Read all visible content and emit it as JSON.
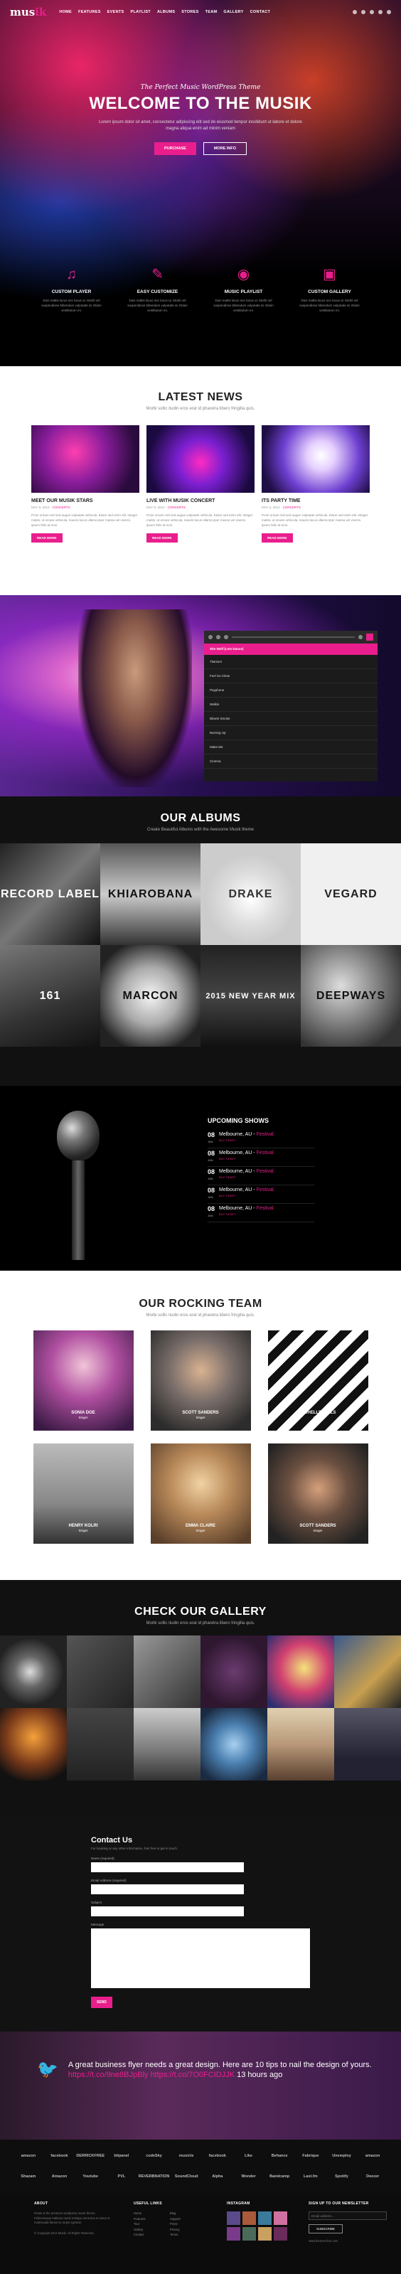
{
  "header": {
    "logo_main": "mus",
    "logo_accent": "ik",
    "menu": [
      "HOME",
      "FEATURES",
      "EVENTS",
      "PLAYLIST",
      "ALBUMS",
      "STORES",
      "TEAM",
      "GALLERY",
      "CONTACT"
    ]
  },
  "hero": {
    "subtitle": "The Perfect Music WordPress Theme",
    "title": "WELCOME TO THE MUSIK",
    "text": "Lorem ipsum dolor sit amet, consectetur adipiscing elit sed do eiusmod tempor incididunt ut labore et dolore magna aliqua enim ad minim veniam",
    "btn_primary": "PURCHASE",
    "btn_secondary": "MORE INFO"
  },
  "features": [
    {
      "icon": "music-note-icon",
      "title": "CUSTOM PLAYER",
      "text": "Duis mattis lacus nec lacus ut. Morbi vel suspendisse bibendum vulputate at. Etiam vestibulum mi."
    },
    {
      "icon": "pencil-icon",
      "title": "EASY CUSTOMIZE",
      "text": "Duis mattis lacus nec lacus ut. Morbi vel suspendisse bibendum vulputate at. Etiam vestibulum mi."
    },
    {
      "icon": "record-icon",
      "title": "MUSIC PLAYLIST",
      "text": "Duis mattis lacus nec lacus ut. Morbi vel suspendisse bibendum vulputate at. Etiam vestibulum mi."
    },
    {
      "icon": "image-icon",
      "title": "CUSTOM GALLERY",
      "text": "Duis mattis lacus nec lacus ut. Morbi vel suspendisse bibendum vulputate at. Etiam vestibulum mi."
    }
  ],
  "news": {
    "title": "LATEST NEWS",
    "subtitle": "Morbi sollic itudin eros erat id pharetra libero fringilla quis.",
    "posts": [
      {
        "title": "MEET OUR MUSIK STARS",
        "date": "MAY 6, 2014",
        "cat": "CONCERTS",
        "text": "Proin ornare nisl sed augue vulputate vehicula. Etiam sed enim elit. Integer mattis, ut ornare vehicula, mauris lacus ullamcorper massa vel viverra ipsum felis at eros.",
        "btn": "READ MORE"
      },
      {
        "title": "LIVE WITH MUSIK CONCERT",
        "date": "MAY 6, 2014",
        "cat": "CONCERTS",
        "text": "Proin ornare nisl sed augue vulputate vehicula. Etiam sed enim elit. Integer mattis, ut ornare vehicula, mauris lacus ullamcorper massa vel viverra ipsum felis at eros.",
        "btn": "READ MORE"
      },
      {
        "title": "ITS PARTY TIME",
        "date": "MAY 6, 2014",
        "cat": "CONCERTS",
        "text": "Proin ornare nisl sed augue vulputate vehicula. Etiam sed enim elit. Integer mattis, ut ornare vehicula, mauris lacus ullamcorper massa vel viverra ipsum felis at eros.",
        "btn": "READ MORE"
      }
    ]
  },
  "player": {
    "now_playing": "She Wolf (Lets Dance)",
    "tracks": [
      "Titanium",
      "Feel So Close",
      "Payphone",
      "Walkin",
      "Blowin Smoke",
      "Burning Up",
      "Make Me",
      "Cinema"
    ]
  },
  "albums": {
    "title": "OUR ALBUMS",
    "subtitle": "Create Beautiful Albums with the Awesome Musik theme",
    "items": [
      "RECORD LABEL",
      "KHIAROBANA",
      "DRAKE",
      "VEGARD",
      "161",
      "MARCON",
      "2015 NEW YEAR MIX",
      "DEEPWAYS"
    ]
  },
  "shows": {
    "title": "UPCOMING SHOWS",
    "items": [
      {
        "day": "08",
        "month": "JAN",
        "place": "Melbourne, AU",
        "venue": "Festival",
        "buy": "BUY TICKET"
      },
      {
        "day": "08",
        "month": "JAN",
        "place": "Melbourne, AU",
        "venue": "Festival",
        "buy": "BUY TICKET"
      },
      {
        "day": "08",
        "month": "JAN",
        "place": "Melbourne, AU",
        "venue": "Festival",
        "buy": "BUY TICKET"
      },
      {
        "day": "08",
        "month": "JAN",
        "place": "Melbourne, AU",
        "venue": "Festival",
        "buy": "BUY TICKET"
      },
      {
        "day": "08",
        "month": "JAN",
        "place": "Melbourne, AU",
        "venue": "Festival",
        "buy": "BUY TICKET"
      }
    ]
  },
  "team": {
    "title": "OUR ROCKING TEAM",
    "subtitle": "Morbi sollic itudin eros erat id pharetra libero fringilla quis.",
    "members": [
      {
        "name": "SONIA DOE",
        "role": "Singer"
      },
      {
        "name": "SCOTT SANDERS",
        "role": "Singer"
      },
      {
        "name": "MICHELLE WILLS",
        "role": "Singer"
      },
      {
        "name": "HENRY KOLRI",
        "role": "Singer"
      },
      {
        "name": "EMMA CLAIRE",
        "role": "Singer"
      },
      {
        "name": "SCOTT SANDERS",
        "role": "Singer"
      }
    ]
  },
  "gallery": {
    "title": "CHECK OUR GALLERY",
    "subtitle": "Morbi sollic itudin eros erat id pharetra libero fringilla quis."
  },
  "contact": {
    "title": "Contact Us",
    "subtitle": "For booking or any other information, feel free to get in touch.",
    "labels": [
      "Name (required)",
      "Email Address (required)",
      "Subject",
      "Message"
    ],
    "send": "SEND"
  },
  "twitter": {
    "text": "A great business flyer needs a great design. Here are 10 tips to nail the design of yours. ",
    "link": "https://t.co/9ne8BJpBly https://t.co/7O0FCIDJJK",
    "time": " 13 hours ago"
  },
  "clients": [
    "amazon",
    "facebook",
    "DERRICKFREE",
    "bitpanel",
    "codeSky",
    "musicle",
    "facebook",
    "Like",
    "Behance",
    "Fabrique",
    "Unemploy",
    "amazon",
    "Shazam",
    "Amazon",
    "Youtube",
    "PVL",
    "REVERBNATION",
    "SoundCloud",
    "Alpha",
    "Wonder",
    "Bandcamp",
    "Last.fm",
    "Spotify",
    "Deezer"
  ],
  "footer": {
    "about_title": "ABOUT",
    "about_text": "Fiesta is the premium wordpress music theme. Pellentesque habitant morbi tristique senectus et netus et malesuada fames ac turpis egestas.",
    "copyright": "© Copyright 2014 Musik. All Rights Reserved.",
    "links_title": "USEFUL LINKS",
    "links": [
      "Home",
      "Blog",
      "Features",
      "Support",
      "Tour",
      "Press",
      "Gallery",
      "Privacy",
      "Contact",
      "Terms"
    ],
    "insta_title": "INSTAGRAM",
    "newsletter_title": "SIGN UP TO OUR NEWSLETTER",
    "newsletter_placeholder": "Email address...",
    "newsletter_btn": "SUBSCRIBE",
    "credit": "www.themes-free.com"
  },
  "colors": {
    "accent": "#e91e8c",
    "dark": "#111111"
  }
}
